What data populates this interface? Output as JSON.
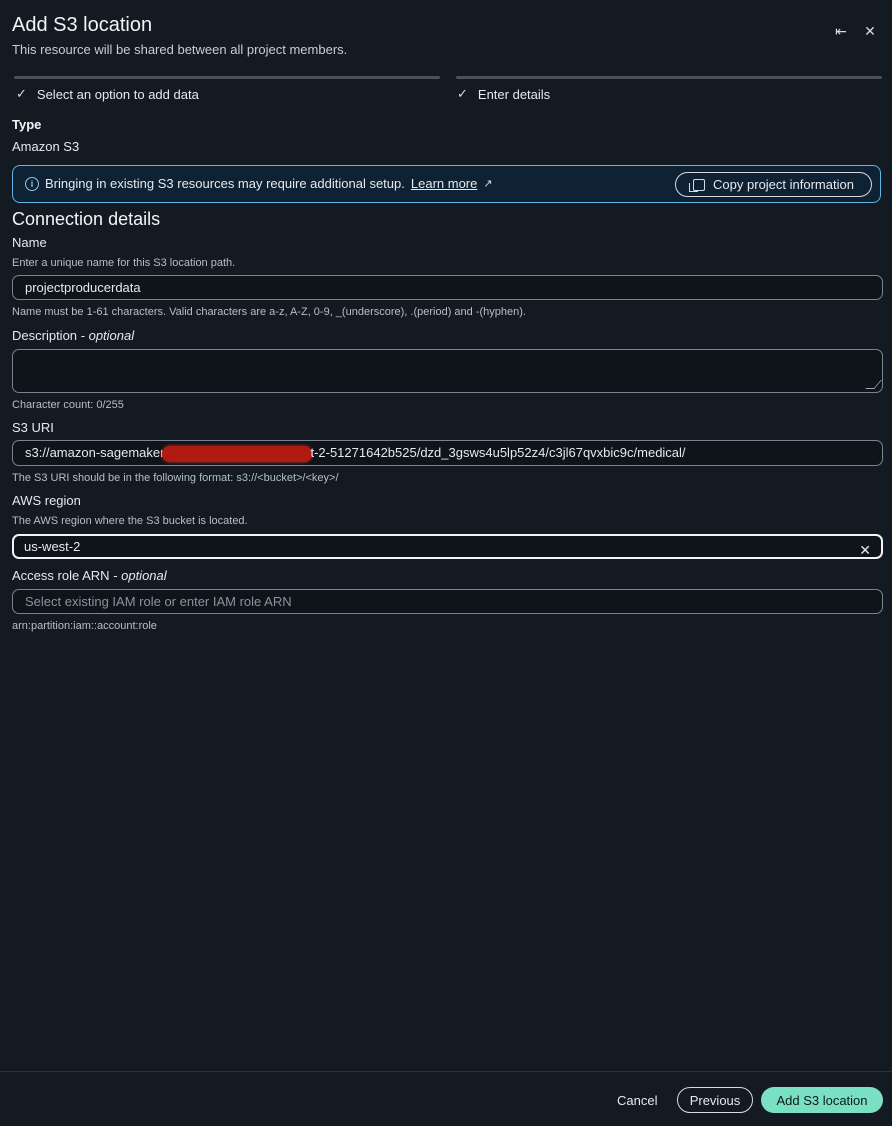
{
  "header": {
    "title": "Add S3 location",
    "subtitle": "This resource will be shared between all project members."
  },
  "steps": [
    {
      "label": "Select an option to add data",
      "status": "complete"
    },
    {
      "label": "Enter details",
      "status": "complete"
    }
  ],
  "type": {
    "label": "Type",
    "value": "Amazon S3"
  },
  "info": {
    "text": "Bringing in existing S3 resources may require additional setup.",
    "link": "Learn more",
    "button": "Copy project information"
  },
  "section": {
    "title": "Connection details"
  },
  "name_field": {
    "label": "Name",
    "description": "Enter a unique name for this S3 location path.",
    "value": "projectproducerdata",
    "constraint": "Name must be 1-61 characters. Valid characters are a-z, A-Z, 0-9, _(underscore), .(period) and -(hyphen)."
  },
  "description_field": {
    "label": "Description",
    "optional": "- optional",
    "counter": "Character count: 0/255"
  },
  "s3_uri_field": {
    "label": "S3 URI",
    "value_prefix": "s3://amazon-sagemaker",
    "value_suffix": "t-2-51271642b525/dzd_3gsws4u5lp52z4/c3jl67qvxbic9c/medical/",
    "constraint": "The S3 URI should be in the following format: s3://<bucket>/<key>/"
  },
  "region_field": {
    "label": "AWS region",
    "description": "The AWS region where the S3 bucket is located.",
    "value": "us-west-2"
  },
  "role_field": {
    "label": "Access role ARN",
    "optional": "- optional",
    "placeholder": "Select existing IAM role or enter IAM role ARN",
    "constraint": "arn:partition:iam::account:role"
  },
  "footer": {
    "cancel": "Cancel",
    "previous": "Previous",
    "submit": "Add S3 location"
  },
  "colors": {
    "background": "#141a22",
    "info_border": "#5fb6e6",
    "primary_button": "#7ae0c4"
  }
}
